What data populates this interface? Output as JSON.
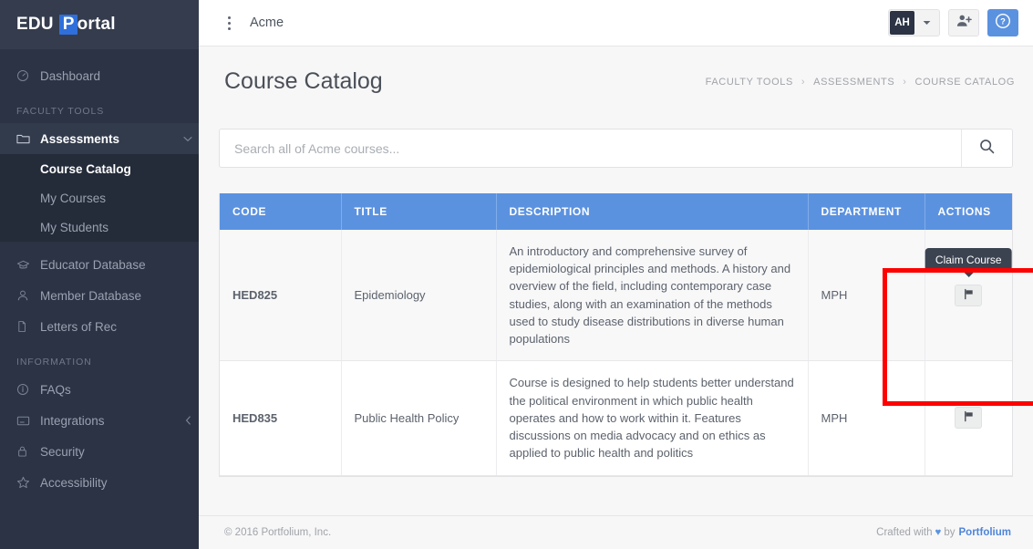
{
  "sidebar": {
    "logo": {
      "pre": "EDU",
      "badge": "P",
      "post": "ortal"
    },
    "items": [
      {
        "label": "Dashboard",
        "icon": "gauge-icon"
      }
    ],
    "sections": [
      {
        "title": "FACULTY TOOLS",
        "items": [
          {
            "label": "Assessments",
            "icon": "folder-icon",
            "caret": "chevron-down-icon",
            "expanded": true,
            "children": [
              {
                "label": "Course Catalog",
                "active": true
              },
              {
                "label": "My Courses",
                "active": false
              },
              {
                "label": "My Students",
                "active": false
              }
            ]
          },
          {
            "label": "Educator Database",
            "icon": "graduation-cap-icon"
          },
          {
            "label": "Member Database",
            "icon": "user-icon"
          },
          {
            "label": "Letters of Rec",
            "icon": "documents-icon"
          }
        ]
      },
      {
        "title": "INFORMATION",
        "items": [
          {
            "label": "FAQs",
            "icon": "info-circle-icon"
          },
          {
            "label": "Integrations",
            "icon": "window-icon",
            "caret": "chevron-left-icon"
          },
          {
            "label": "Security",
            "icon": "lock-icon"
          },
          {
            "label": "Accessibility",
            "icon": "star-icon"
          }
        ]
      }
    ]
  },
  "topbar": {
    "menu_icon": "kebab-menu-icon",
    "org_name": "Acme",
    "avatar_initials": "AH",
    "avatar_caret": "caret-down-icon",
    "add_user_icon": "add-user-icon",
    "help_icon": "question-circle-icon"
  },
  "page": {
    "title": "Course Catalog",
    "breadcrumb": [
      "FACULTY TOOLS",
      "ASSESSMENTS",
      "COURSE CATALOG"
    ],
    "breadcrumb_separator": "›"
  },
  "search": {
    "placeholder": "Search all of Acme courses...",
    "value": "",
    "button_icon": "search-icon"
  },
  "table": {
    "columns": [
      "CODE",
      "TITLE",
      "DESCRIPTION",
      "DEPARTMENT",
      "ACTIONS"
    ],
    "rows": [
      {
        "code": "HED825",
        "title": "Epidemiology",
        "description": "An introductory and comprehensive survey of epidemiological principles and methods. A history and overview of the field, including contemporary case studies, along with an examination of the methods used to study disease distributions in diverse human populations",
        "department": "MPH",
        "action_icon": "flag-icon",
        "tooltip": "Claim Course",
        "tooltip_visible": true
      },
      {
        "code": "HED835",
        "title": "Public Health Policy",
        "description": "Course is designed to help students better understand the political environment in which public health operates and how to work within it. Features discussions on media advocacy and on ethics as applied to public health and politics",
        "department": "MPH",
        "action_icon": "flag-icon",
        "tooltip": "Claim Course",
        "tooltip_visible": false
      }
    ]
  },
  "footer": {
    "copyright": "© 2016 Portfolium, Inc.",
    "crafted_prefix": "Crafted with",
    "heart": "♥",
    "crafted_mid": "by",
    "brand": "Portfolium"
  },
  "colors": {
    "sidebar_bg": "#2b3344",
    "sidebar_submenu_bg": "#242b39",
    "table_header_blue": "#5b92e0",
    "accent_blue": "#5b92e0",
    "annotation_red": "#fe0000"
  }
}
